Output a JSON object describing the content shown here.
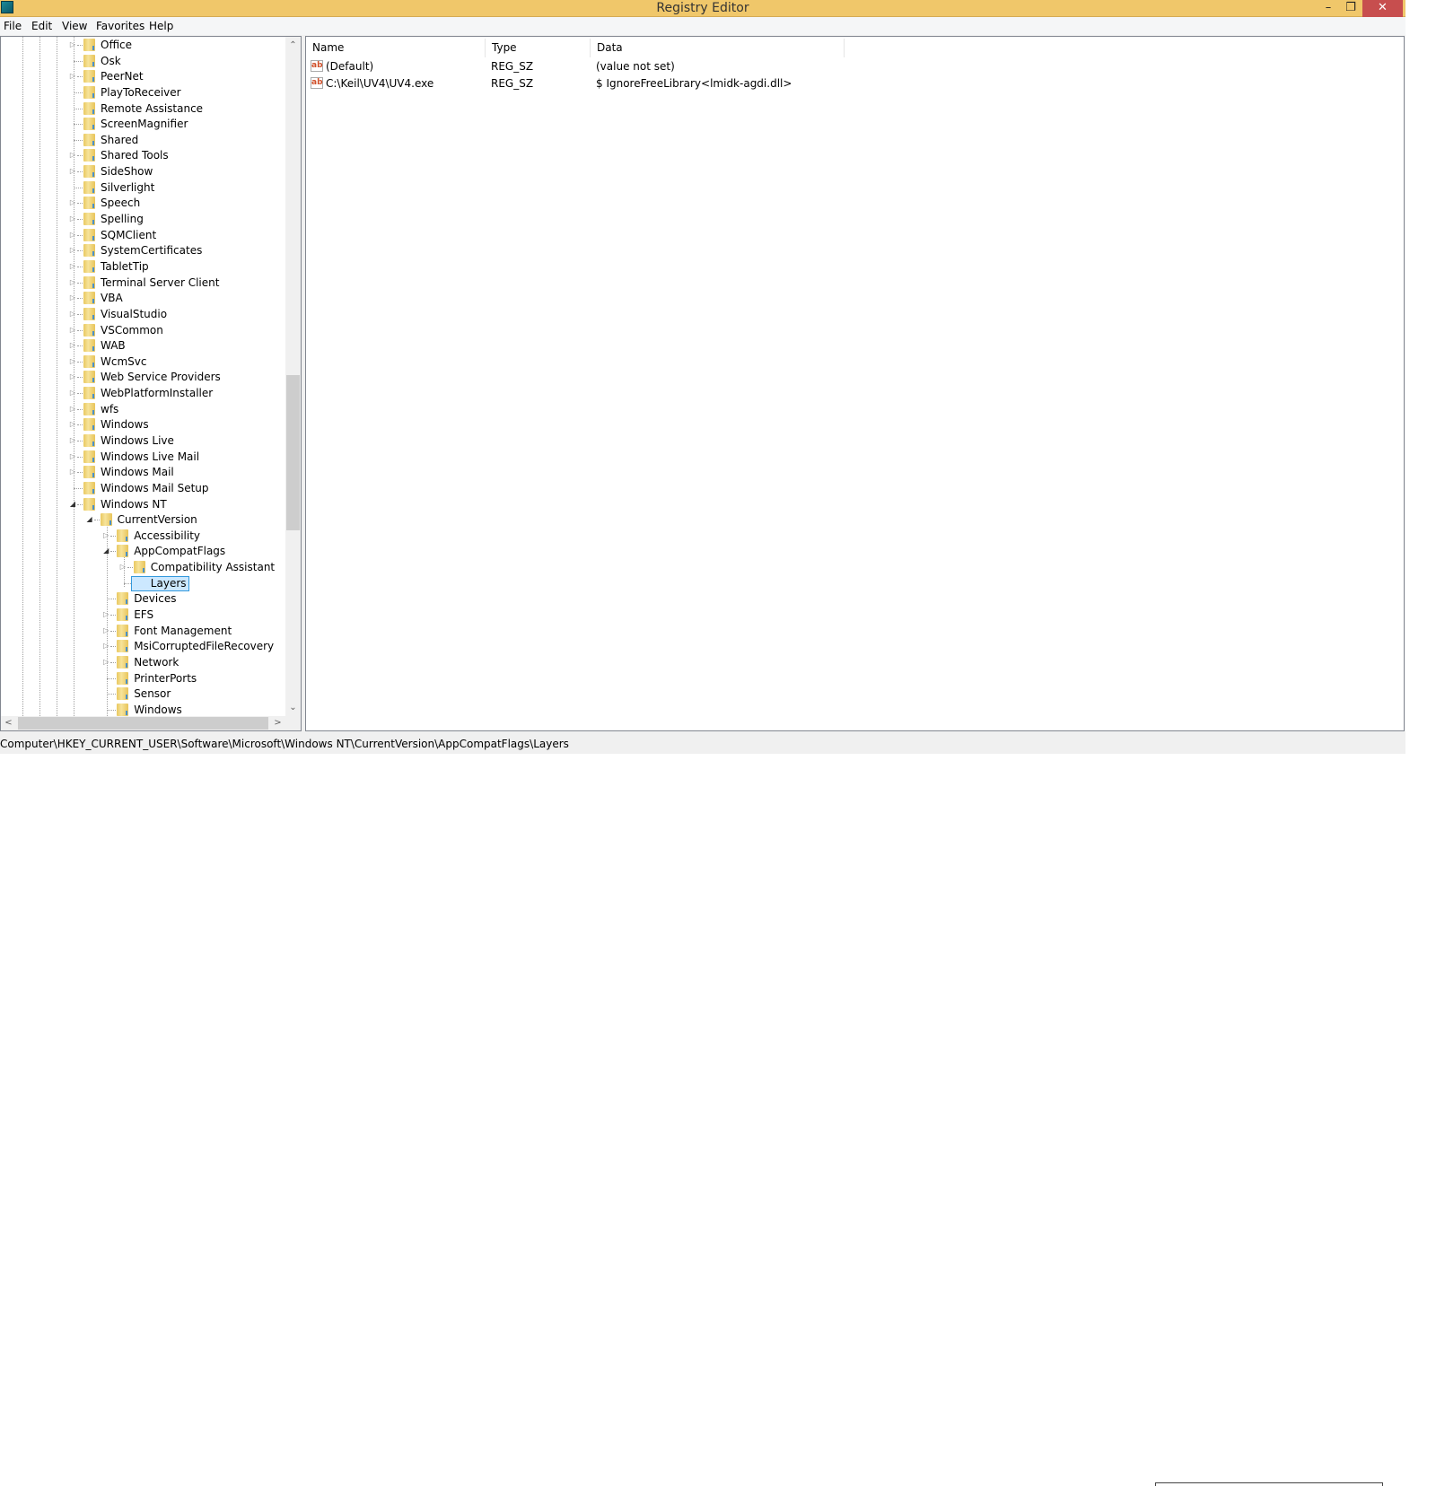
{
  "window": {
    "title": "Registry Editor",
    "minimize": "–",
    "maximize": "❐",
    "close": "✕"
  },
  "menu": [
    "File",
    "Edit",
    "View",
    "Favorites",
    "Help"
  ],
  "tree": [
    {
      "label": "Office",
      "level": 1,
      "exp": "c"
    },
    {
      "label": "Osk",
      "level": 1,
      "exp": "n"
    },
    {
      "label": "PeerNet",
      "level": 1,
      "exp": "c"
    },
    {
      "label": "PlayToReceiver",
      "level": 1,
      "exp": "n"
    },
    {
      "label": "Remote Assistance",
      "level": 1,
      "exp": "n"
    },
    {
      "label": "ScreenMagnifier",
      "level": 1,
      "exp": "n"
    },
    {
      "label": "Shared",
      "level": 1,
      "exp": "n"
    },
    {
      "label": "Shared Tools",
      "level": 1,
      "exp": "c"
    },
    {
      "label": "SideShow",
      "level": 1,
      "exp": "c"
    },
    {
      "label": "Silverlight",
      "level": 1,
      "exp": "n"
    },
    {
      "label": "Speech",
      "level": 1,
      "exp": "c"
    },
    {
      "label": "Spelling",
      "level": 1,
      "exp": "c"
    },
    {
      "label": "SQMClient",
      "level": 1,
      "exp": "c"
    },
    {
      "label": "SystemCertificates",
      "level": 1,
      "exp": "c"
    },
    {
      "label": "TabletTip",
      "level": 1,
      "exp": "c"
    },
    {
      "label": "Terminal Server Client",
      "level": 1,
      "exp": "c"
    },
    {
      "label": "VBA",
      "level": 1,
      "exp": "c"
    },
    {
      "label": "VisualStudio",
      "level": 1,
      "exp": "c"
    },
    {
      "label": "VSCommon",
      "level": 1,
      "exp": "c"
    },
    {
      "label": "WAB",
      "level": 1,
      "exp": "c"
    },
    {
      "label": "WcmSvc",
      "level": 1,
      "exp": "c"
    },
    {
      "label": "Web Service Providers",
      "level": 1,
      "exp": "c"
    },
    {
      "label": "WebPlatformInstaller",
      "level": 1,
      "exp": "c"
    },
    {
      "label": "wfs",
      "level": 1,
      "exp": "c"
    },
    {
      "label": "Windows",
      "level": 1,
      "exp": "c"
    },
    {
      "label": "Windows Live",
      "level": 1,
      "exp": "c"
    },
    {
      "label": "Windows Live Mail",
      "level": 1,
      "exp": "c"
    },
    {
      "label": "Windows Mail",
      "level": 1,
      "exp": "c"
    },
    {
      "label": "Windows Mail Setup",
      "level": 1,
      "exp": "n"
    },
    {
      "label": "Windows NT",
      "level": 1,
      "exp": "e"
    },
    {
      "label": "CurrentVersion",
      "level": 2,
      "exp": "e"
    },
    {
      "label": "Accessibility",
      "level": 3,
      "exp": "c"
    },
    {
      "label": "AppCompatFlags",
      "level": 3,
      "exp": "e"
    },
    {
      "label": "Compatibility Assistant",
      "level": 4,
      "exp": "c"
    },
    {
      "label": "Layers",
      "level": 4,
      "exp": "n",
      "selected": true
    },
    {
      "label": "Devices",
      "level": 3,
      "exp": "n"
    },
    {
      "label": "EFS",
      "level": 3,
      "exp": "c"
    },
    {
      "label": "Font Management",
      "level": 3,
      "exp": "c"
    },
    {
      "label": "MsiCorruptedFileRecovery",
      "level": 3,
      "exp": "c"
    },
    {
      "label": "Network",
      "level": 3,
      "exp": "c"
    },
    {
      "label": "PrinterPorts",
      "level": 3,
      "exp": "n"
    },
    {
      "label": "Sensor",
      "level": 3,
      "exp": "n"
    },
    {
      "label": "Windows",
      "level": 3,
      "exp": "n"
    }
  ],
  "scroll": {
    "up": "⌃",
    "down": "⌄",
    "left": "<",
    "right": ">"
  },
  "list": {
    "columns": [
      "Name",
      "Type",
      "Data"
    ],
    "rows": [
      {
        "icon": "ab",
        "name": "(Default)",
        "type": "REG_SZ",
        "data": "(value not set)"
      },
      {
        "icon": "ab",
        "name": "C:\\Keil\\UV4\\UV4.exe",
        "type": "REG_SZ",
        "data": "$ IgnoreFreeLibrary<lmidk-agdi.dll>"
      }
    ]
  },
  "status": "Computer\\HKEY_CURRENT_USER\\Software\\Microsoft\\Windows NT\\CurrentVersion\\AppCompatFlags\\Layers"
}
